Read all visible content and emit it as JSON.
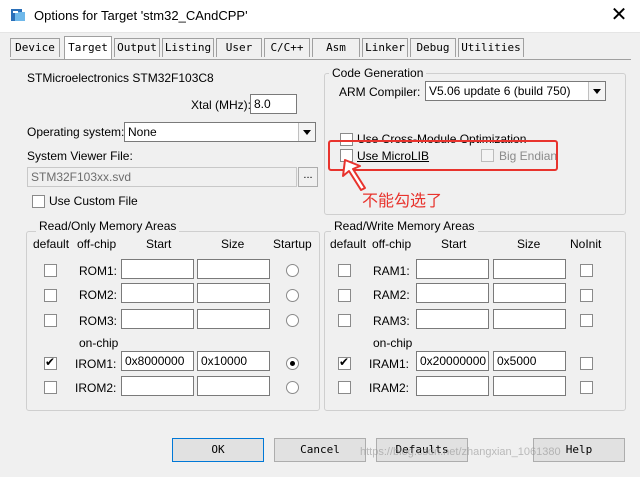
{
  "window": {
    "title": "Options for Target 'stm32_CAndCPP'",
    "close_glyph": "✕"
  },
  "tabs": [
    "Device",
    "Target",
    "Output",
    "Listing",
    "User",
    "C/C++",
    "Asm",
    "Linker",
    "Debug",
    "Utilities"
  ],
  "active_tab": "Target",
  "device": "STMicroelectronics STM32F103C8",
  "xtal": {
    "label": "Xtal (MHz):",
    "value": "8.0"
  },
  "os": {
    "label": "Operating system:",
    "value": "None"
  },
  "svd": {
    "label": "System Viewer File:",
    "value": "STM32F103xx.svd",
    "browse": "..."
  },
  "use_custom_file": "Use Custom File",
  "code_generation": {
    "legend": "Code Generation",
    "compiler_label": "ARM Compiler:",
    "compiler_value": "V5.06 update 6 (build 750)",
    "cross_module": "Use Cross-Module Optimization",
    "microlib": "Use MicroLIB",
    "big_endian": "Big Endian"
  },
  "annotation": "不能勾选了",
  "ro_memory": {
    "legend": "Read/Only Memory Areas",
    "headers": {
      "default": "default",
      "offchip": "off-chip",
      "start": "Start",
      "size": "Size",
      "startup": "Startup"
    },
    "onchip": "on-chip",
    "rows": [
      {
        "name": "ROM1:",
        "start": "",
        "size": "",
        "checked": false,
        "startup": false
      },
      {
        "name": "ROM2:",
        "start": "",
        "size": "",
        "checked": false,
        "startup": false
      },
      {
        "name": "ROM3:",
        "start": "",
        "size": "",
        "checked": false,
        "startup": false
      },
      {
        "name": "IROM1:",
        "start": "0x8000000",
        "size": "0x10000",
        "checked": true,
        "startup": true
      },
      {
        "name": "IROM2:",
        "start": "",
        "size": "",
        "checked": false,
        "startup": false
      }
    ]
  },
  "rw_memory": {
    "legend": "Read/Write Memory Areas",
    "headers": {
      "default": "default",
      "offchip": "off-chip",
      "start": "Start",
      "size": "Size",
      "noinit": "NoInit"
    },
    "onchip": "on-chip",
    "rows": [
      {
        "name": "RAM1:",
        "start": "",
        "size": "",
        "checked": false
      },
      {
        "name": "RAM2:",
        "start": "",
        "size": "",
        "checked": false
      },
      {
        "name": "RAM3:",
        "start": "",
        "size": "",
        "checked": false
      },
      {
        "name": "IRAM1:",
        "start": "0x20000000",
        "size": "0x5000",
        "checked": true
      },
      {
        "name": "IRAM2:",
        "start": "",
        "size": "",
        "checked": false
      }
    ]
  },
  "buttons": {
    "ok": "OK",
    "cancel": "Cancel",
    "defaults": "Defaults",
    "help": "Help"
  },
  "watermark": "https://blog.csdn.net/zhangxian_1061380",
  "check_glyph": "✔",
  "colors": {
    "annotation_red": "#e8332d",
    "focus_blue": "#0078d7"
  }
}
